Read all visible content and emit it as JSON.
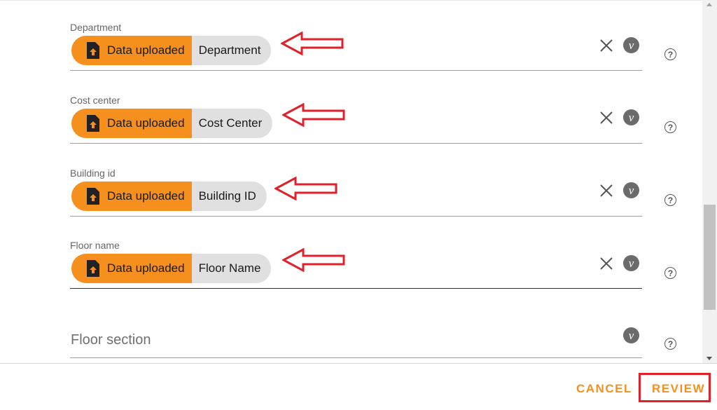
{
  "fields": [
    {
      "label": "Department",
      "chip_source": "Data uploaded",
      "chip_value": "Department"
    },
    {
      "label": "Cost center",
      "chip_source": "Data uploaded",
      "chip_value": "Cost Center"
    },
    {
      "label": "Building id",
      "chip_source": "Data uploaded",
      "chip_value": "Building ID"
    },
    {
      "label": "Floor name",
      "chip_source": "Data uploaded",
      "chip_value": "Floor Name"
    }
  ],
  "floor_section": {
    "label": "Floor section"
  },
  "icons": {
    "clear": "close-icon",
    "variable": "v-icon",
    "help": "help-icon",
    "file": "file-upload-icon",
    "annotation": "red-arrow-icon",
    "v_glyph": "v",
    "help_glyph": "?"
  },
  "footer": {
    "cancel_label": "CANCEL",
    "review_label": "REVIEW"
  },
  "colors": {
    "accent": "#f5901e",
    "chip_bg": "#e0e0e0",
    "annotation": "#e0202a",
    "icon_gray": "#6b6b6b"
  }
}
